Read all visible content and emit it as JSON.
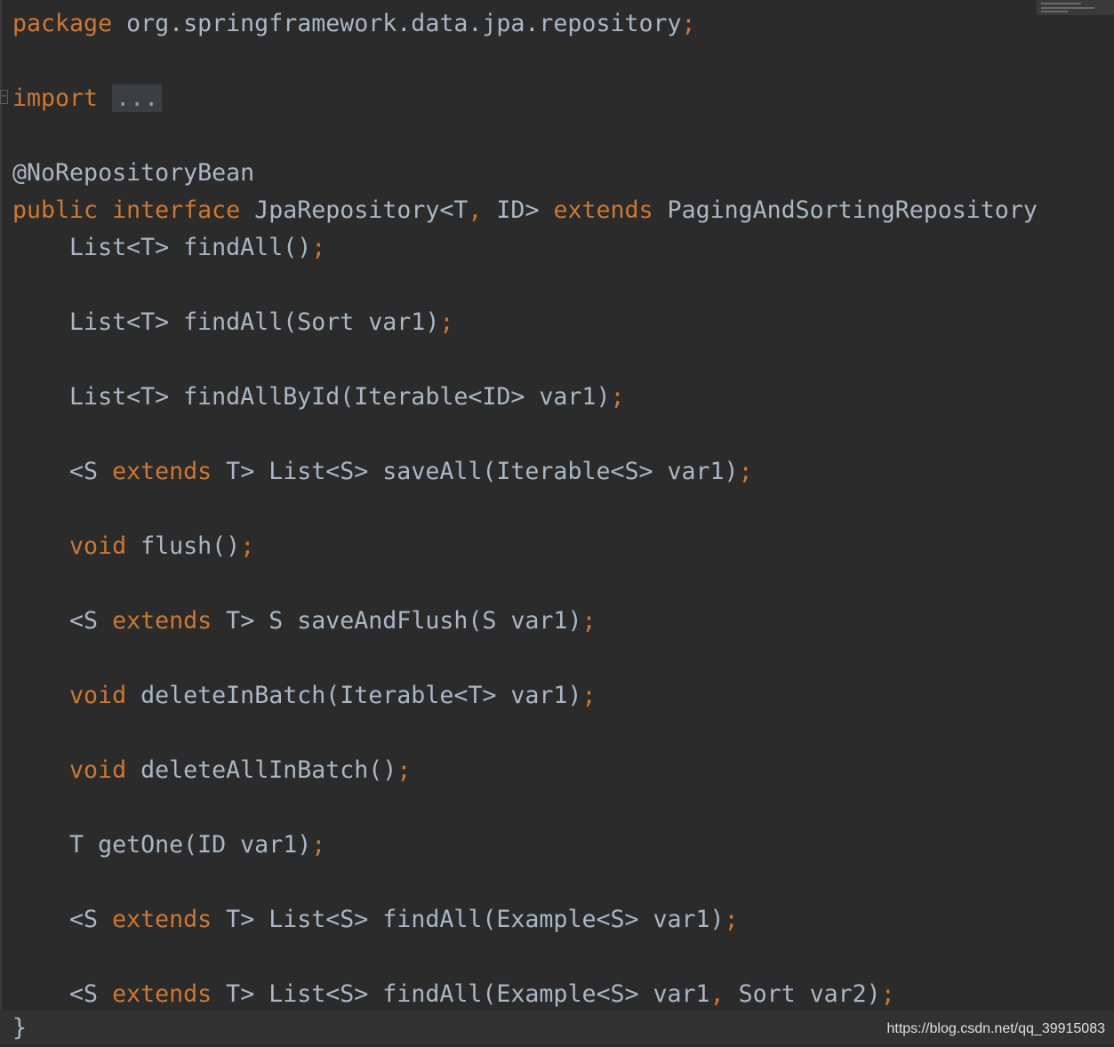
{
  "code": {
    "package_kw": "package",
    "package_name": " org.springframework.data.jpa.repository",
    "semicolon": ";",
    "import_kw": "import",
    "import_fold": "...",
    "annotation": "@NoRepositoryBean",
    "decl_public": "public",
    "decl_interface": "interface",
    "decl_name": " JpaRepository<T",
    "decl_comma": ",",
    "decl_id": " ID> ",
    "decl_extends": "extends",
    "decl_parent": " PagingAndSortingRepository",
    "closing_brace": "}"
  },
  "methods": [
    {
      "indent": "    ",
      "pre": "",
      "pre_kw": "",
      "sig": "List<T> findAll()",
      "mid_kw": "",
      "tail": "",
      "end": ";"
    },
    {
      "indent": "    ",
      "pre": "",
      "pre_kw": "",
      "sig": "List<T> findAll(Sort var1)",
      "mid_kw": "",
      "tail": "",
      "end": ";"
    },
    {
      "indent": "    ",
      "pre": "",
      "pre_kw": "",
      "sig": "List<T> findAllById(Iterable<ID> var1)",
      "mid_kw": "",
      "tail": "",
      "end": ";"
    },
    {
      "indent": "    ",
      "pre": "<S ",
      "pre_kw": "extends",
      "sig": " T> List<S> saveAll(Iterable<S> var1)",
      "mid_kw": "",
      "tail": "",
      "end": ";"
    },
    {
      "indent": "    ",
      "pre": "",
      "pre_kw": "void",
      "sig": " flush()",
      "mid_kw": "",
      "tail": "",
      "end": ";"
    },
    {
      "indent": "    ",
      "pre": "<S ",
      "pre_kw": "extends",
      "sig": " T> S saveAndFlush(S var1)",
      "mid_kw": "",
      "tail": "",
      "end": ";"
    },
    {
      "indent": "    ",
      "pre": "",
      "pre_kw": "void",
      "sig": " deleteInBatch(Iterable<T> var1)",
      "mid_kw": "",
      "tail": "",
      "end": ";"
    },
    {
      "indent": "    ",
      "pre": "",
      "pre_kw": "void",
      "sig": " deleteAllInBatch()",
      "mid_kw": "",
      "tail": "",
      "end": ";"
    },
    {
      "indent": "    ",
      "pre": "",
      "pre_kw": "",
      "sig": "T getOne(ID var1)",
      "mid_kw": "",
      "tail": "",
      "end": ";"
    },
    {
      "indent": "    ",
      "pre": "<S ",
      "pre_kw": "extends",
      "sig": " T> List<S> findAll(Example<S> var1)",
      "mid_kw": "",
      "tail": "",
      "end": ";"
    },
    {
      "indent": "    ",
      "pre": "<S ",
      "pre_kw": "extends",
      "sig": " T> List<S> findAll(Example<S> var1",
      "mid_kw": ",",
      "tail": " Sort var2)",
      "end": ";"
    }
  ],
  "watermark": "https://blog.csdn.net/qq_39915083",
  "colors": {
    "background": "#2b2b2b",
    "keyword": "#cc7832",
    "text": "#a9b7c6",
    "fold_bg": "#3c3f41"
  }
}
